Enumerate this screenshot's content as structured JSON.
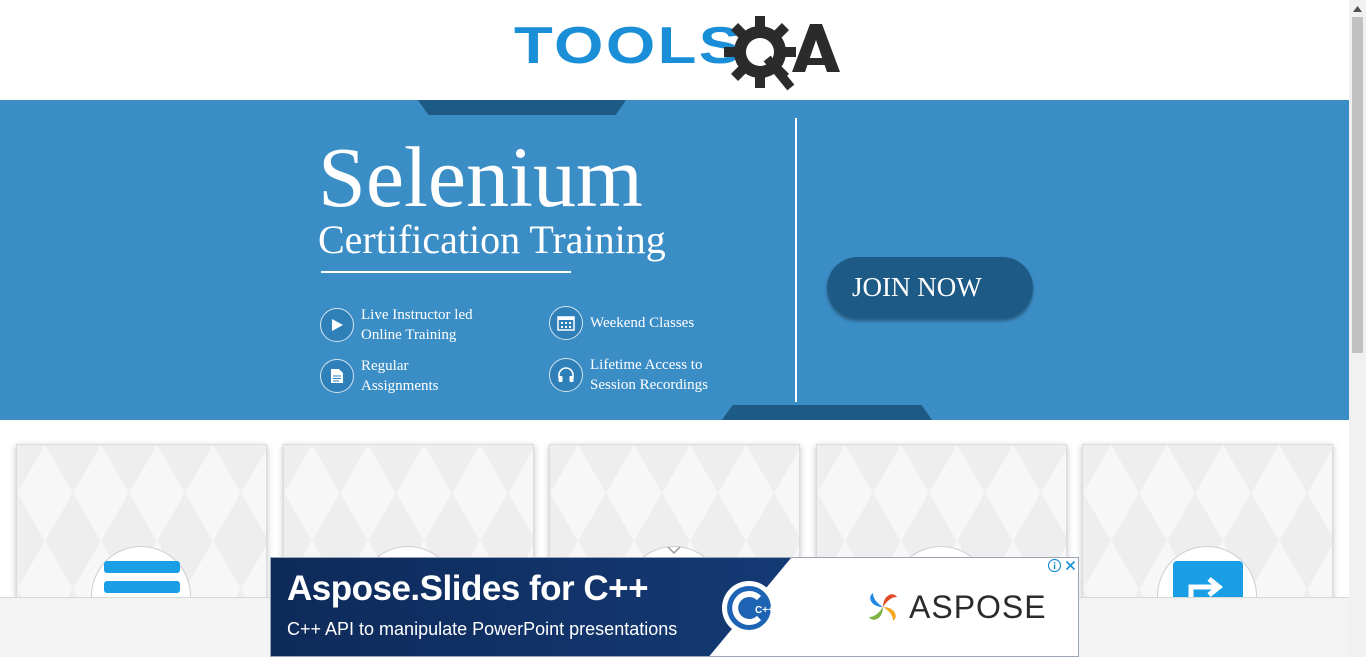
{
  "header": {
    "logo_text": "TOOLS",
    "logo_suffix": "QA"
  },
  "banner": {
    "title": "Selenium",
    "subtitle": "Certification Training",
    "features": [
      {
        "icon": "play-icon",
        "label": "Live Instructor led\nOnline Training"
      },
      {
        "icon": "calendar-icon",
        "label": "Weekend Classes"
      },
      {
        "icon": "document-icon",
        "label": "Regular\nAssignments"
      },
      {
        "icon": "headphones-icon",
        "label": "Lifetime Access to\nSession Recordings"
      }
    ],
    "join_label": "JOIN NOW",
    "colors": {
      "background": "#3b8dc6",
      "accent": "#1e5a86"
    }
  },
  "cards": [
    {
      "icon": "menu-bars-icon"
    },
    {
      "icon": "blank-icon"
    },
    {
      "icon": "chevron-down-icon"
    },
    {
      "icon": "blank-icon"
    },
    {
      "icon": "share-icon"
    }
  ],
  "ad": {
    "title": "Aspose.Slides for C++",
    "subtitle": "C++ API to manipulate PowerPoint presentations",
    "brand": "ASPOSE",
    "badge": "C++"
  }
}
